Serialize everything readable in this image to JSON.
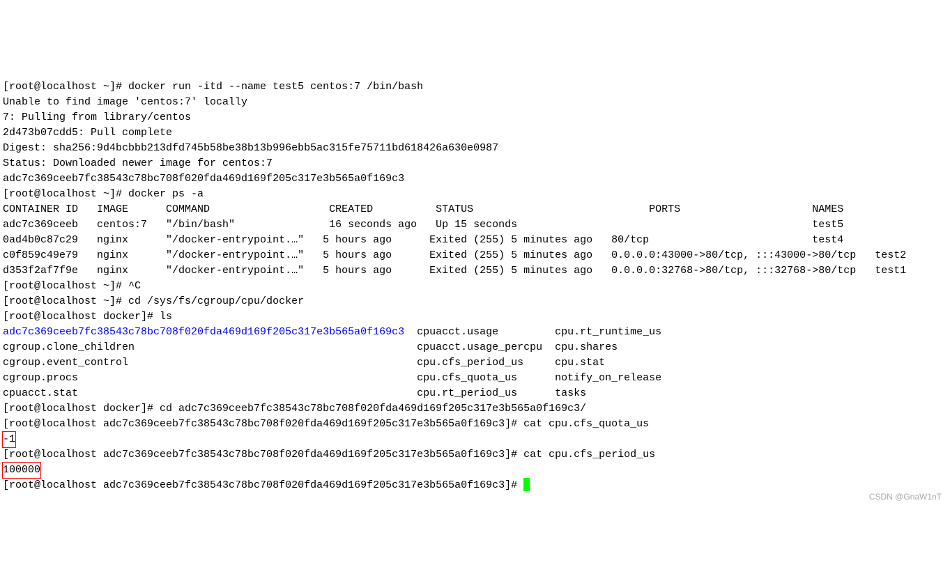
{
  "lines": {
    "l1": "[root@localhost ~]# docker run -itd --name test5 centos:7 /bin/bash",
    "l2": "Unable to find image 'centos:7' locally",
    "l3": "7: Pulling from library/centos",
    "l4": "2d473b07cdd5: Pull complete",
    "l5": "Digest: sha256:9d4bcbbb213dfd745b58be38b13b996ebb5ac315fe75711bd618426a630e0987",
    "l6": "Status: Downloaded newer image for centos:7",
    "l7": "adc7c369ceeb7fc38543c78bc708f020fda469d169f205c317e3b565a0f169c3",
    "l8": "[root@localhost ~]# docker ps -a",
    "l9": "CONTAINER ID   IMAGE      COMMAND                   CREATED          STATUS                            PORTS                     NAMES",
    "l10": "adc7c369ceeb   centos:7   \"/bin/bash\"               16 seconds ago   Up 15 seconds                                               test5",
    "l11": "0ad4b0c87c29   nginx      \"/docker-entrypoint.…\"   5 hours ago      Exited (255) 5 minutes ago   80/tcp                          test4",
    "l12": "c0f859c49e79   nginx      \"/docker-entrypoint.…\"   5 hours ago      Exited (255) 5 minutes ago   0.0.0.0:43000->80/tcp, :::43000->80/tcp   test2",
    "l13": "d353f2af7f9e   nginx      \"/docker-entrypoint.…\"   5 hours ago      Exited (255) 5 minutes ago   0.0.0.0:32768->80/tcp, :::32768->80/tcp   test1",
    "l14": "[root@localhost ~]# ^C",
    "l15": "[root@localhost ~]# cd /sys/fs/cgroup/cpu/docker",
    "l16": "[root@localhost docker]# ls",
    "ls_link": "adc7c369ceeb7fc38543c78bc708f020fda469d169f205c317e3b565a0f169c3",
    "ls_row1_b": "  cpuacct.usage         cpu.rt_runtime_us",
    "ls_row2": "cgroup.clone_children                                             cpuacct.usage_percpu  cpu.shares",
    "ls_row3": "cgroup.event_control                                              cpu.cfs_period_us     cpu.stat",
    "ls_row4": "cgroup.procs                                                      cpu.cfs_quota_us      notify_on_release",
    "ls_row5": "cpuacct.stat                                                      cpu.rt_period_us      tasks",
    "l17": "[root@localhost docker]# cd adc7c369ceeb7fc38543c78bc708f020fda469d169f205c317e3b565a0f169c3/",
    "l18": "[root@localhost adc7c369ceeb7fc38543c78bc708f020fda469d169f205c317e3b565a0f169c3]# cat cpu.cfs_quota_us",
    "val_quota": "-1",
    "l19": "[root@localhost adc7c369ceeb7fc38543c78bc708f020fda469d169f205c317e3b565a0f169c3]# cat cpu.cfs_period_us",
    "val_period": "100000",
    "l20": "[root@localhost adc7c369ceeb7fc38543c78bc708f020fda469d169f205c317e3b565a0f169c3]# "
  },
  "watermark": "CSDN @GnaW1nT"
}
